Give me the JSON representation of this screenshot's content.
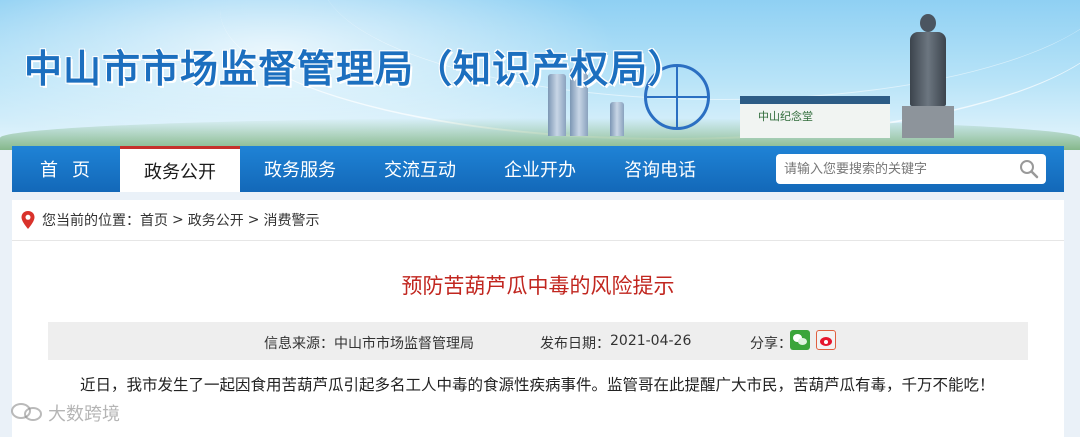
{
  "header": {
    "site_title": "中山市市场监督管理局（知识产权局）",
    "building_sign": "中山纪念堂"
  },
  "nav": {
    "items": [
      {
        "label": "首页"
      },
      {
        "label": "政务公开",
        "active": true
      },
      {
        "label": "政务服务"
      },
      {
        "label": "交流互动"
      },
      {
        "label": "企业开办"
      },
      {
        "label": "咨询电话"
      }
    ],
    "search_placeholder": "请输入您要搜索的关键字"
  },
  "breadcrumb": {
    "prefix": "您当前的位置：",
    "items": [
      "首页",
      "政务公开",
      "消费警示"
    ],
    "separator": ">"
  },
  "article": {
    "title": "预防苦葫芦瓜中毒的风险提示",
    "source_label": "信息来源：",
    "source_value": "中山市市场监督管理局",
    "date_label": "发布日期：",
    "date_value": "2021-04-26",
    "share_label": "分享：",
    "share_icons": [
      "wechat-icon",
      "weibo-icon"
    ],
    "body": "近日，我市发生了一起因食用苦葫芦瓜引起多名工人中毒的食源性疾病事件。监管哥在此提醒广大市民，苦葫芦瓜有毒，千万不能吃！"
  },
  "watermark": {
    "text": "大数跨境"
  },
  "colors": {
    "nav_bg": "#1368b8",
    "title_red": "#c1261f",
    "site_title_blue": "#1c6fbf"
  }
}
